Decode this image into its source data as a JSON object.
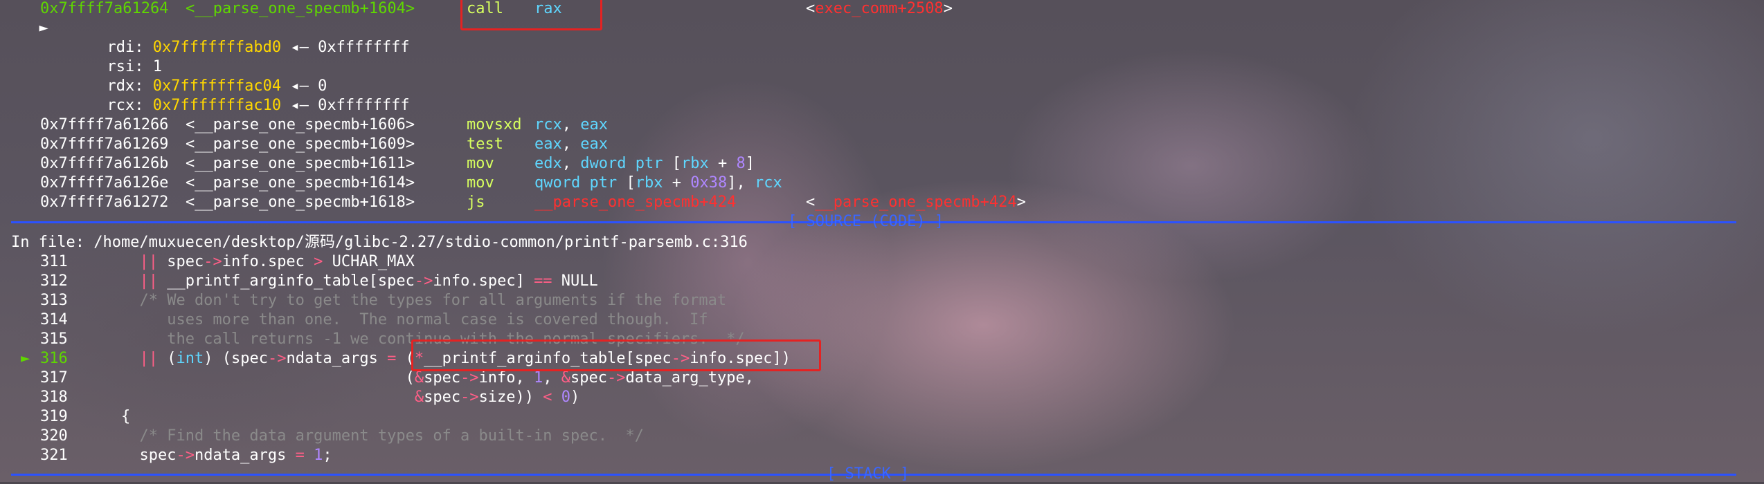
{
  "colors": {
    "address": "#5fd700",
    "pointer": "#ffd700",
    "symbol_red": "#ff3030",
    "register": "#5fd7ff",
    "number": "#af87ff",
    "operator": "#ff5f87",
    "comment": "#8a8a8a",
    "separator": "#2b52ff",
    "highlight_box": "#e52222"
  },
  "disasm": {
    "current": {
      "marker": "►",
      "address": "0x7ffff7a61264",
      "symbol": "<__parse_one_specmb+1604>",
      "mnemonic": "call",
      "operand": "rax",
      "target": "<exec_comm+2508>"
    },
    "args": [
      {
        "reg": "rdi:",
        "ptr": "0x7fffffffabd0",
        "arrow": "◂—",
        "val": "0xffffffff"
      },
      {
        "reg": "rsi:",
        "ptr": "",
        "arrow": "",
        "val": "1"
      },
      {
        "reg": "rdx:",
        "ptr": "0x7fffffffac04",
        "arrow": "◂—",
        "val": "0"
      },
      {
        "reg": "rcx:",
        "ptr": "0x7fffffffac10",
        "arrow": "◂—",
        "val": "0xffffffff"
      }
    ],
    "rows": [
      {
        "address": "0x7ffff7a61266",
        "symbol": "<__parse_one_specmb+1606>",
        "mnemonic": "movsxd",
        "op1": "rcx",
        "op2": "eax"
      },
      {
        "address": "0x7ffff7a61269",
        "symbol": "<__parse_one_specmb+1609>",
        "mnemonic": "test",
        "op1": "eax",
        "op2": "eax"
      },
      {
        "address": "0x7ffff7a6126b",
        "symbol": "<__parse_one_specmb+1611>",
        "mnemonic": "mov",
        "op1": "edx",
        "op2": "dword ptr [rbx + 8]"
      },
      {
        "address": "0x7ffff7a6126e",
        "symbol": "<__parse_one_specmb+1614>",
        "mnemonic": "mov",
        "op1": "qword ptr [rbx + 0x38]",
        "op2": "rcx"
      },
      {
        "address": "0x7ffff7a61272",
        "symbol": "<__parse_one_specmb+1618>",
        "mnemonic": "js",
        "op1": "__parse_one_specmb+424",
        "op2": "",
        "target": "<__parse_one_specmb+424>"
      }
    ]
  },
  "source": {
    "header": "[ SOURCE (CODE) ]",
    "file_label": "In file: /home/muxuecen/desktop/源码/glibc-2.27/stdio-common/printf-parsemb.c:316",
    "current_marker": "►",
    "lines": [
      {
        "num": "311",
        "code": "      || spec->info.spec > UCHAR_MAX"
      },
      {
        "num": "312",
        "code": "      || __printf_arginfo_table[spec->info.spec] == NULL"
      },
      {
        "num": "313",
        "code": "      /* We don't try to get the types for all arguments if the format"
      },
      {
        "num": "314",
        "code": "         uses more than one.  The normal case is covered though.  If"
      },
      {
        "num": "315",
        "code": "         the call returns -1 we continue with the normal specifiers.  */"
      },
      {
        "num": "316",
        "code": "      || (int) (spec->ndata_args = (*__printf_arginfo_table[spec->info.spec])"
      },
      {
        "num": "317",
        "code": "                                   (&spec->info, 1, &spec->data_arg_type,"
      },
      {
        "num": "318",
        "code": "                                    &spec->size)) < 0)"
      },
      {
        "num": "319",
        "code": "    {"
      },
      {
        "num": "320",
        "code": "      /* Find the data argument types of a built-in spec.  */"
      },
      {
        "num": "321",
        "code": "      spec->ndata_args = 1;"
      }
    ]
  },
  "stack": {
    "header": "[ STACK ]"
  }
}
